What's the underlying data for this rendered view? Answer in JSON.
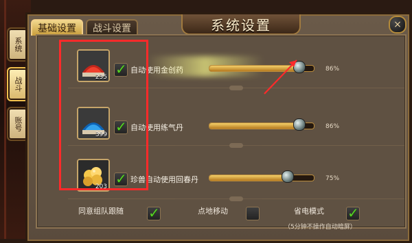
{
  "window": {
    "title": "系统设置",
    "close_symbol": "×"
  },
  "side_tabs": [
    {
      "label": "系统",
      "active": false
    },
    {
      "label": "战斗",
      "active": true
    },
    {
      "label": "账号",
      "active": false
    }
  ],
  "tabs": [
    {
      "label": "基础设置",
      "active": true
    },
    {
      "label": "战斗设置",
      "active": false
    }
  ],
  "rows": [
    {
      "count": "235",
      "label": "自动使用金创药",
      "checked": true,
      "slider": 0.86,
      "percent_text": "86%",
      "icon": "red-powder-icon"
    },
    {
      "count": "399",
      "label": "自动使用练气丹",
      "checked": true,
      "slider": 0.86,
      "percent_text": "86%",
      "icon": "blue-powder-icon"
    },
    {
      "count": "203",
      "label": "珍兽自动使用回春丹",
      "checked": true,
      "slider": 0.75,
      "percent_text": "75%",
      "icon": "golden-pills-icon"
    }
  ],
  "bottom_options": [
    {
      "label": "同意组队跟随",
      "checked": true
    },
    {
      "label": "点地移动",
      "checked": false
    },
    {
      "label": "省电模式",
      "checked": true
    }
  ],
  "power_save_note": "（5分钟不操作自动暗屏）",
  "colors": {
    "accent": "#f3cf6a",
    "check": "#58d227",
    "annotation": "#ff2a2a"
  }
}
